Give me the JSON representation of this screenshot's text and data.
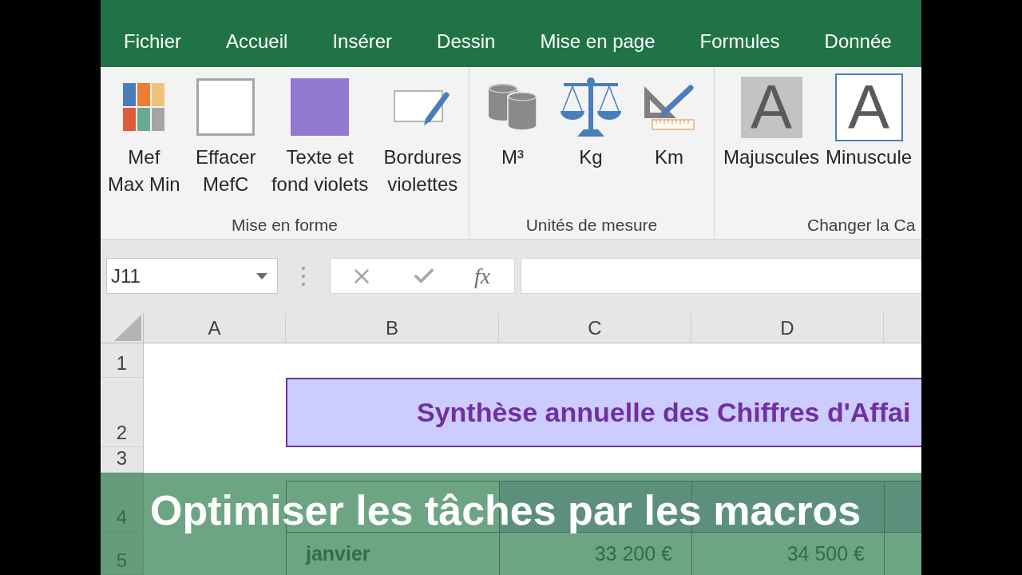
{
  "ribbon_tabs": [
    {
      "label": "Fichier"
    },
    {
      "label": "Accueil"
    },
    {
      "label": "Insérer"
    },
    {
      "label": "Dessin"
    },
    {
      "label": "Mise en page"
    },
    {
      "label": "Formules"
    },
    {
      "label": "Donnée"
    }
  ],
  "ribbon_groups": [
    {
      "label": "Mise en forme",
      "buttons": [
        {
          "kind": "grid",
          "label_lines": [
            "Mef",
            "Max Min"
          ]
        },
        {
          "kind": "blank",
          "label_lines": [
            "Effacer",
            "MefC"
          ]
        },
        {
          "kind": "fill",
          "label_lines": [
            "Texte et",
            "fond violets"
          ]
        },
        {
          "kind": "border",
          "label_lines": [
            "Bordures",
            "violettes"
          ]
        }
      ]
    },
    {
      "label": "Unités de mesure",
      "buttons": [
        {
          "kind": "volume",
          "label_lines": [
            "M³"
          ]
        },
        {
          "kind": "weight",
          "label_lines": [
            "Kg"
          ]
        },
        {
          "kind": "distance",
          "label_lines": [
            "Km"
          ]
        }
      ]
    },
    {
      "label": "Changer la Ca",
      "buttons": [
        {
          "kind": "uppercase",
          "icon_text": "A",
          "label_lines": [
            "Majuscules"
          ]
        },
        {
          "kind": "lowercase",
          "icon_text": "A",
          "label_lines": [
            "Minuscule"
          ]
        }
      ]
    }
  ],
  "formula_bar": {
    "name_box": "J11",
    "function_button": "fx"
  },
  "sheet": {
    "columns": [
      "A",
      "B",
      "C",
      "D"
    ],
    "rows": [
      {
        "number": "1",
        "kind": "blank"
      },
      {
        "number": "2",
        "kind": "title",
        "title": "Synthèse annuelle des Chiffres d'Affai"
      },
      {
        "number": "3",
        "kind": "blank"
      },
      {
        "number": "4",
        "kind": "table_header"
      },
      {
        "number": "5",
        "kind": "table_row",
        "cells": [
          "janvier",
          "33 200 €",
          "34 500 €"
        ]
      }
    ]
  },
  "caption_banner": {
    "text": "Optimiser les tâches par les macros"
  }
}
